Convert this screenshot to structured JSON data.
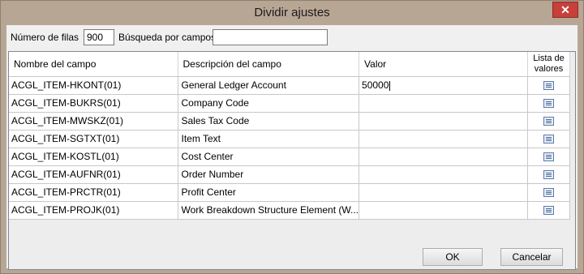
{
  "window": {
    "title": "Dividir ajustes",
    "close_label": "✕"
  },
  "toolbar": {
    "rows_label": "Número de filas",
    "rows_value": "900",
    "search_label": "Búsqueda por campos",
    "search_value": ""
  },
  "table": {
    "columns": [
      "Nombre del campo",
      "Descripción del campo",
      "Valor",
      "Lista de valores"
    ],
    "rows": [
      {
        "field": "ACGL_ITEM-HKONT(01)",
        "description": "General Ledger Account",
        "value": "50000",
        "icon": "list-icon"
      },
      {
        "field": "ACGL_ITEM-BUKRS(01)",
        "description": "Company Code",
        "value": "",
        "icon": "list-icon"
      },
      {
        "field": "ACGL_ITEM-MWSKZ(01)",
        "description": "Sales Tax Code",
        "value": "",
        "icon": "list-icon"
      },
      {
        "field": "ACGL_ITEM-SGTXT(01)",
        "description": "Item Text",
        "value": "",
        "icon": "list-icon"
      },
      {
        "field": "ACGL_ITEM-KOSTL(01)",
        "description": "Cost Center",
        "value": "",
        "icon": "list-icon"
      },
      {
        "field": "ACGL_ITEM-AUFNR(01)",
        "description": "Order Number",
        "value": "",
        "icon": "list-icon"
      },
      {
        "field": "ACGL_ITEM-PRCTR(01)",
        "description": "Profit Center",
        "value": "",
        "icon": "list-icon"
      },
      {
        "field": "ACGL_ITEM-PROJK(01)",
        "description": "Work Breakdown Structure Element (W...",
        "value": "",
        "icon": "list-icon"
      }
    ]
  },
  "buttons": {
    "ok": "OK",
    "cancel": "Cancelar"
  }
}
